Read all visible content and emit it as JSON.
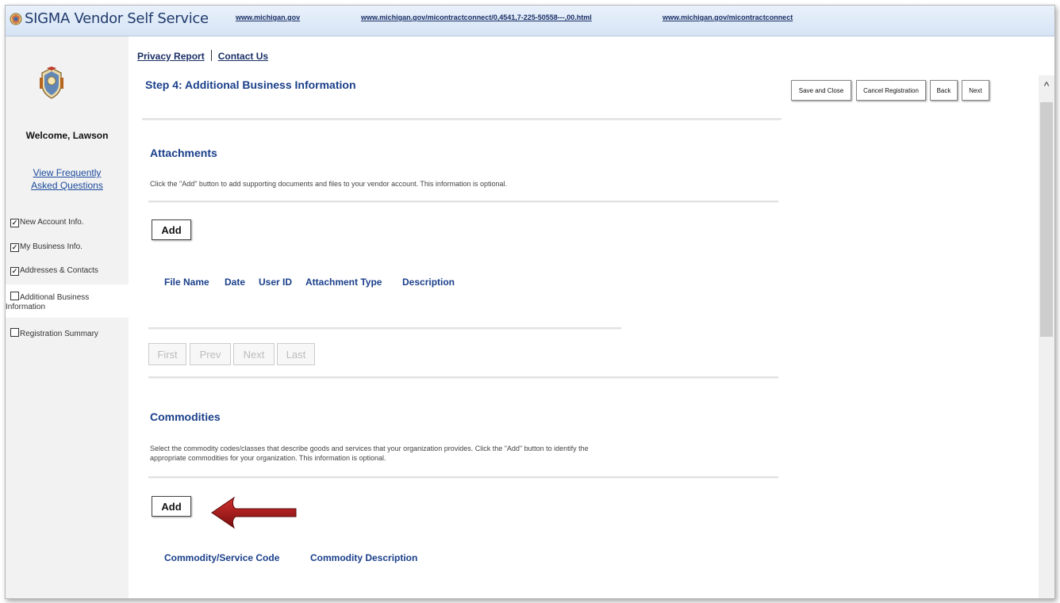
{
  "header": {
    "app_title": "SIGMA Vendor Self Service",
    "links": [
      "www.michigan.gov",
      "www.michigan.gov/micontractconnect/0,4541,7-225-50558---,00.html",
      "www.michigan.gov/micontractconnect"
    ]
  },
  "sidebar": {
    "welcome": "Welcome, Lawson",
    "faq_line1": "View Frequently",
    "faq_line2": "Asked Questions",
    "items": [
      {
        "label": "New Account Info.",
        "checked": true
      },
      {
        "label": "My Business Info.",
        "checked": true
      },
      {
        "label": "Addresses & Contacts",
        "checked": true
      },
      {
        "label_line1": "Additional Business",
        "label_line2": "Information",
        "checked": false
      },
      {
        "label": "Registration Summary",
        "checked": false
      }
    ]
  },
  "toplinks": {
    "privacy": "Privacy Report",
    "contact": "Contact Us"
  },
  "page": {
    "title": "Step 4: Additional Business Information"
  },
  "actions": {
    "save_close": "Save and Close",
    "cancel": "Cancel Registration",
    "back": "Back",
    "next": "Next"
  },
  "attachments": {
    "title": "Attachments",
    "description": "Click the \"Add\" button to add supporting documents and files to your vendor account. This information is optional.",
    "add_label": "Add",
    "columns": [
      "File Name",
      "Date",
      "User ID",
      "Attachment Type",
      "Description"
    ],
    "pager": [
      "First",
      "Prev",
      "Next",
      "Last"
    ]
  },
  "commodities": {
    "title": "Commodities",
    "description_line1": "Select the commodity codes/classes that describe goods and services that your organization provides. Click the \"Add\" button to identify the",
    "description_line2": "appropriate commodities for your organization. This information is optional.",
    "add_label": "Add",
    "columns": [
      "Commodity/Service Code",
      "Commodity Description"
    ]
  },
  "colors": {
    "heading_blue": "#1a3f8a",
    "link_navy": "#1a2f66",
    "arrow_red": "#a01818"
  },
  "icons": {
    "state_seal": "michigan-seal-icon",
    "checkbox_checked": "checkbox-checked-icon",
    "checkbox_empty": "checkbox-empty-icon",
    "pointer_arrow": "red-arrow-icon",
    "scroll_up": "chevron-up-icon"
  }
}
